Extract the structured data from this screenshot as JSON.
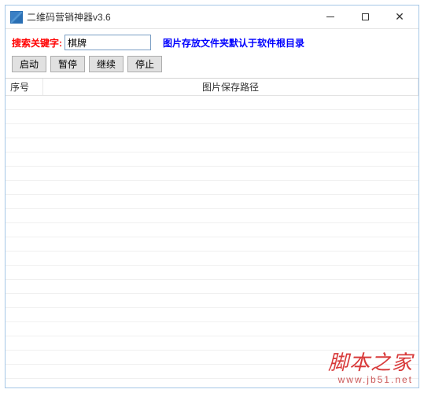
{
  "window": {
    "title": "二维码营销神器v3.6"
  },
  "search": {
    "label": "搜索关键字:",
    "value": "棋牌"
  },
  "notice": "图片存放文件夹默认于软件根目录",
  "toolbar": {
    "start": "启动",
    "pause": "暂停",
    "resume": "继续",
    "stop": "停止"
  },
  "table": {
    "col_seq": "序号",
    "col_path": "图片保存路径"
  },
  "watermark": {
    "main": "脚本之家",
    "sub": "www.jb51.net"
  }
}
